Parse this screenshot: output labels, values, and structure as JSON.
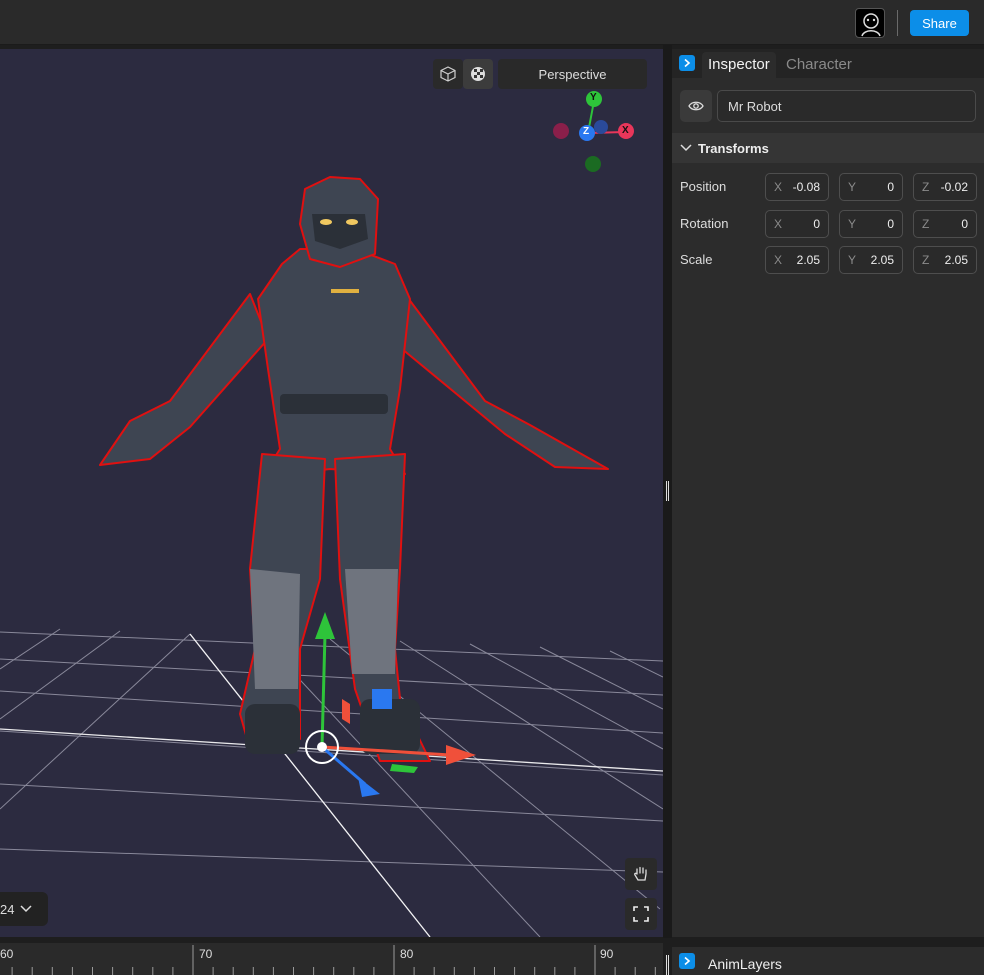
{
  "topbar": {
    "avatar_icon": "user-avatar-icon",
    "share_label": "Share"
  },
  "viewport": {
    "view_toggles": [
      "cube-icon",
      "checker-icon"
    ],
    "camera_label": "Perspective",
    "gizmo": {
      "y_label": "Y",
      "z_label": "Z",
      "x_label": "X"
    },
    "fps_value": "24",
    "tools": [
      "hand-icon",
      "fullscreen-icon"
    ]
  },
  "inspector": {
    "tabs": [
      {
        "label": "Inspector",
        "active": true
      },
      {
        "label": "Character",
        "active": false
      }
    ],
    "object_name": "Mr Robot",
    "section_title": "Transforms",
    "rows": [
      {
        "label": "Position",
        "values": [
          {
            "axis": "X",
            "value": "-0.08"
          },
          {
            "axis": "Y",
            "value": "0"
          },
          {
            "axis": "Z",
            "value": "-0.02"
          }
        ]
      },
      {
        "label": "Rotation",
        "values": [
          {
            "axis": "X",
            "value": "0"
          },
          {
            "axis": "Y",
            "value": "0"
          },
          {
            "axis": "Z",
            "value": "0"
          }
        ]
      },
      {
        "label": "Scale",
        "values": [
          {
            "axis": "X",
            "value": "2.05"
          },
          {
            "axis": "Y",
            "value": "2.05"
          },
          {
            "axis": "Z",
            "value": "2.05"
          }
        ]
      }
    ]
  },
  "timeline": {
    "labels": [
      "60",
      "70",
      "80",
      "90"
    ]
  },
  "animlayers": {
    "label": "AnimLayers"
  },
  "colors": {
    "accent": "#0c8ee8",
    "viewport_bg": "#2c2b40",
    "axis_x": "#e8365a",
    "axis_y": "#2ec43a",
    "axis_z": "#2a78f0",
    "selection_outline": "#e01010"
  }
}
